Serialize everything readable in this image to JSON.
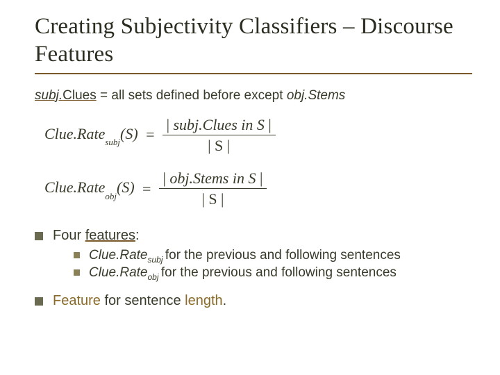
{
  "title": "Creating Subjectivity Classifiers – Discourse Features",
  "def": {
    "term_prefix": "subj.",
    "term_word": "Clues",
    "mid": " = all sets defined before except ",
    "obj": "obj.Stems"
  },
  "eq1": {
    "lhs_main": "Clue.Rate",
    "lhs_sub": "subj",
    "arg": "(S) ",
    "eq": "=",
    "num_open": "| ",
    "num_text": "subj.Clues in S",
    "num_close": " |",
    "den": "| S |"
  },
  "eq2": {
    "lhs_main": "Clue.Rate",
    "lhs_sub": "obj",
    "arg": "(S) ",
    "eq": "=",
    "num_open": "| ",
    "num_text": "obj.Stems in S",
    "num_close": " |",
    "den": "| S |"
  },
  "four": {
    "lead": "Four ",
    "ul": "features",
    "tail": ":"
  },
  "sub1": {
    "name": "Clue.Rate",
    "sub": "subj ",
    "rest": "for the previous and following sentences"
  },
  "sub2": {
    "name": "Clue.Rate",
    "sub": "obj ",
    "rest": "for the previous and following sentences"
  },
  "last": {
    "a": "Feature",
    "b": " for sentence ",
    "c": "length",
    "d": "."
  }
}
